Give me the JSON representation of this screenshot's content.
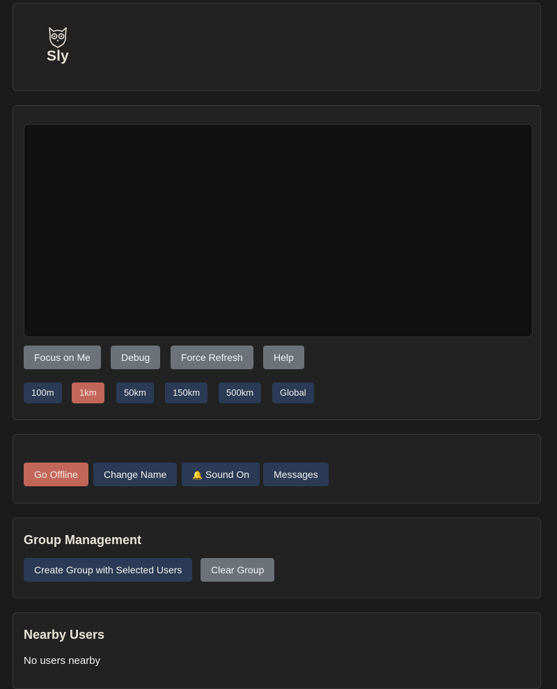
{
  "brand": {
    "name": "Sly",
    "icon": "owl-icon"
  },
  "map": {
    "buttons": {
      "focus": "Focus on Me",
      "debug": "Debug",
      "refresh": "Force Refresh",
      "help": "Help"
    },
    "ranges": [
      "100m",
      "1km",
      "50km",
      "150km",
      "500km",
      "Global"
    ],
    "active_range": "1km"
  },
  "controls": {
    "offline": "Go Offline",
    "change_name": "Change Name",
    "sound_icon": "bell-icon",
    "sound": "Sound On",
    "messages": "Messages"
  },
  "group": {
    "title": "Group Management",
    "create": "Create Group with Selected Users",
    "clear": "Clear Group"
  },
  "nearby": {
    "title": "Nearby Users",
    "empty": "No users nearby"
  },
  "colors": {
    "background": "#1b1b1b",
    "card": "#222222",
    "accent_red": "#c2665a",
    "navy": "#2b3b55",
    "gray": "#6d7279"
  }
}
